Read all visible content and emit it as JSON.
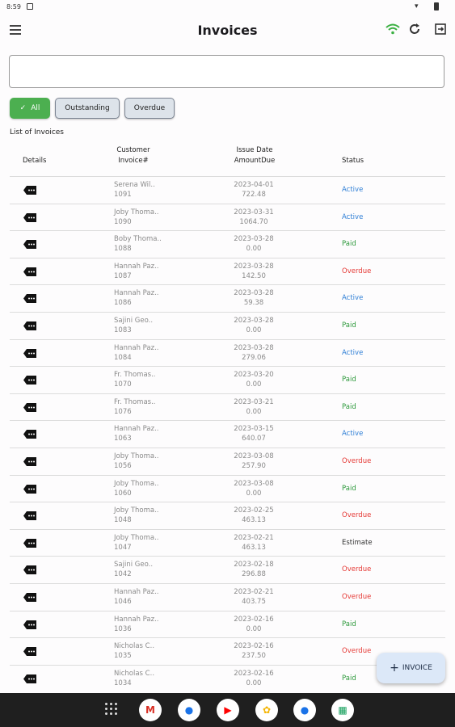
{
  "status_bar": {
    "time": "8:59"
  },
  "app_bar": {
    "title": "Invoices"
  },
  "search": {
    "value": "",
    "placeholder": ""
  },
  "filters": {
    "all": "All",
    "outstanding": "Outstanding",
    "overdue": "Overdue"
  },
  "list_title": "List of Invoices",
  "headers": {
    "details": "Details",
    "customer": "Customer",
    "invoice_num": "Invoice#",
    "issue_date": "Issue Date",
    "amount_due": "AmountDue",
    "status": "Status"
  },
  "rows": [
    {
      "customer": "Serena Wil..",
      "invoice": "1091",
      "date": "2023-04-01",
      "amount": "722.48",
      "status": "Active"
    },
    {
      "customer": "Joby Thoma..",
      "invoice": "1090",
      "date": "2023-03-31",
      "amount": "1064.70",
      "status": "Active"
    },
    {
      "customer": "Boby Thoma..",
      "invoice": "1088",
      "date": "2023-03-28",
      "amount": "0.00",
      "status": "Paid"
    },
    {
      "customer": "Hannah Paz..",
      "invoice": "1087",
      "date": "2023-03-28",
      "amount": "142.50",
      "status": "Overdue"
    },
    {
      "customer": "Hannah Paz..",
      "invoice": "1086",
      "date": "2023-03-28",
      "amount": "59.38",
      "status": "Active"
    },
    {
      "customer": "Sajini Geo..",
      "invoice": "1083",
      "date": "2023-03-28",
      "amount": "0.00",
      "status": "Paid"
    },
    {
      "customer": "Hannah Paz..",
      "invoice": "1084",
      "date": "2023-03-28",
      "amount": "279.06",
      "status": "Active"
    },
    {
      "customer": "Fr. Thomas..",
      "invoice": "1070",
      "date": "2023-03-20",
      "amount": "0.00",
      "status": "Paid"
    },
    {
      "customer": "Fr. Thomas..",
      "invoice": "1076",
      "date": "2023-03-21",
      "amount": "0.00",
      "status": "Paid"
    },
    {
      "customer": "Hannah Paz..",
      "invoice": "1063",
      "date": "2023-03-15",
      "amount": "640.07",
      "status": "Active"
    },
    {
      "customer": "Joby Thoma..",
      "invoice": "1056",
      "date": "2023-03-08",
      "amount": "257.90",
      "status": "Overdue"
    },
    {
      "customer": "Joby Thoma..",
      "invoice": "1060",
      "date": "2023-03-08",
      "amount": "0.00",
      "status": "Paid"
    },
    {
      "customer": "Joby Thoma..",
      "invoice": "1048",
      "date": "2023-02-25",
      "amount": "463.13",
      "status": "Overdue"
    },
    {
      "customer": "Joby Thoma..",
      "invoice": "1047",
      "date": "2023-02-21",
      "amount": "463.13",
      "status": "Estimate"
    },
    {
      "customer": "Sajini Geo..",
      "invoice": "1042",
      "date": "2023-02-18",
      "amount": "296.88",
      "status": "Overdue"
    },
    {
      "customer": "Hannah Paz..",
      "invoice": "1046",
      "date": "2023-02-21",
      "amount": "403.75",
      "status": "Overdue"
    },
    {
      "customer": "Hannah Paz..",
      "invoice": "1036",
      "date": "2023-02-16",
      "amount": "0.00",
      "status": "Paid"
    },
    {
      "customer": "Nicholas C..",
      "invoice": "1035",
      "date": "2023-02-16",
      "amount": "237.50",
      "status": "Overdue"
    },
    {
      "customer": "Nicholas C..",
      "invoice": "1034",
      "date": "2023-02-16",
      "amount": "0.00",
      "status": "Paid"
    }
  ],
  "status_colors": {
    "Active": "#2f7fd6",
    "Paid": "#2e9a3c",
    "Overdue": "#e53935",
    "Estimate": "#333333"
  },
  "fab": {
    "label": "INVOICE"
  },
  "nav_apps": [
    {
      "name": "gmail-icon",
      "glyph": "M",
      "color": "#d93025"
    },
    {
      "name": "chrome-icon",
      "glyph": "●",
      "color": "#1a73e8"
    },
    {
      "name": "youtube-icon",
      "glyph": "▶",
      "color": "#ff0000"
    },
    {
      "name": "photos-icon",
      "glyph": "✿",
      "color": "#f4b400"
    },
    {
      "name": "messages-icon",
      "glyph": "●",
      "color": "#1a73e8"
    },
    {
      "name": "sheets-icon",
      "glyph": "▦",
      "color": "#0f9d58"
    }
  ]
}
